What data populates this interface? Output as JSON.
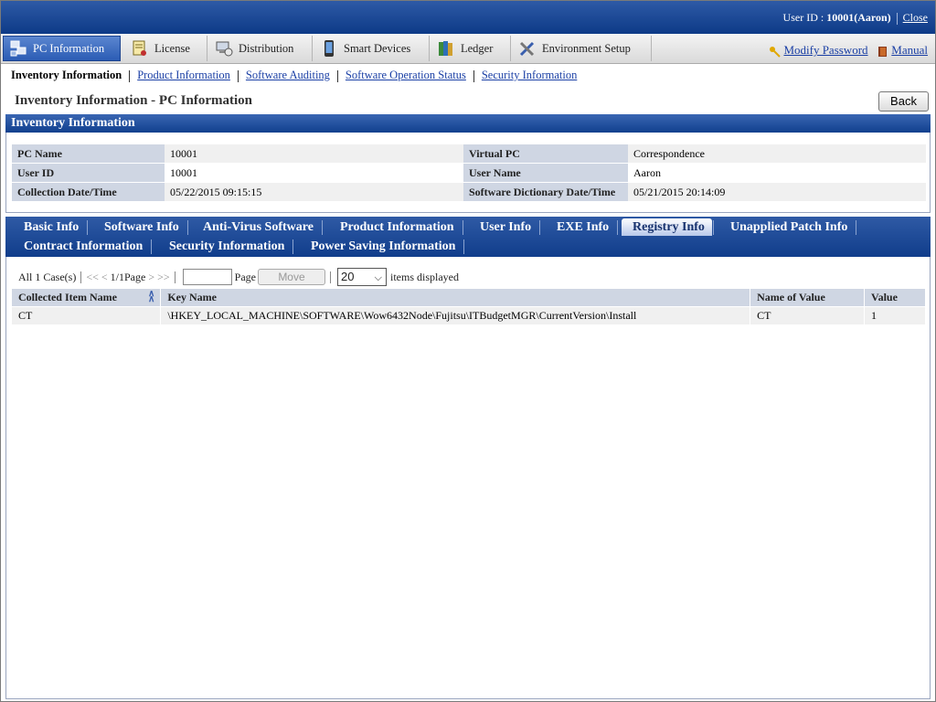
{
  "header": {
    "user_id_label": "User ID : ",
    "user_id_value": "10001(Aaron)",
    "close_label": "Close"
  },
  "menu": {
    "tabs": [
      {
        "label": "PC Information",
        "icon": "pc-network-icon"
      },
      {
        "label": "License",
        "icon": "license-certificate-icon"
      },
      {
        "label": "Distribution",
        "icon": "distribution-pc-icon"
      },
      {
        "label": "Smart Devices",
        "icon": "smart-device-icon"
      },
      {
        "label": "Ledger",
        "icon": "ledger-book-icon"
      },
      {
        "label": "Environment Setup",
        "icon": "tools-icon"
      }
    ],
    "modify_password": "Modify Password",
    "manual": "Manual"
  },
  "submenu": {
    "current": "Inventory Information",
    "links": [
      "Product Information",
      "Software Auditing",
      "Software Operation Status",
      "Security Information"
    ]
  },
  "page": {
    "title": "Inventory Information - PC Information",
    "back_label": "Back"
  },
  "inventory": {
    "section_title": "Inventory Information",
    "rows": [
      {
        "l1": "PC Name",
        "v1": "10001",
        "l2": "Virtual PC",
        "v2": "Correspondence"
      },
      {
        "l1": "User ID",
        "v1": "10001",
        "l2": "User Name",
        "v2": "Aaron"
      },
      {
        "l1": "Collection Date/Time",
        "v1": "05/22/2015 09:15:15",
        "l2": "Software Dictionary Date/Time",
        "v2": "05/21/2015 20:14:09"
      }
    ]
  },
  "tabs": {
    "row1": [
      "Basic Info",
      "Software Info",
      "Anti-Virus Software",
      "Product Information",
      "User Info",
      "EXE Info",
      "Registry Info",
      "Unapplied Patch Info"
    ],
    "row2": [
      "Contract Information",
      "Security Information",
      "Power Saving Information"
    ],
    "active": "Registry Info"
  },
  "pager": {
    "count": "All 1 Case(s)",
    "first": "<<",
    "prev": "<",
    "page_status": "1/1Page",
    "next": ">",
    "last": ">>",
    "page_input_value": "",
    "page_label": "Page",
    "move_label": "Move",
    "per_page": "20",
    "items_label": "items displayed"
  },
  "grid": {
    "headers": [
      "Collected Item Name",
      "Key Name",
      "Name of Value",
      "Value"
    ],
    "rows": [
      [
        "CT",
        "\\HKEY_LOCAL_MACHINE\\SOFTWARE\\Wow6432Node\\Fujitsu\\ITBudgetMGR\\CurrentVersion\\Install",
        "CT",
        "1"
      ]
    ]
  }
}
